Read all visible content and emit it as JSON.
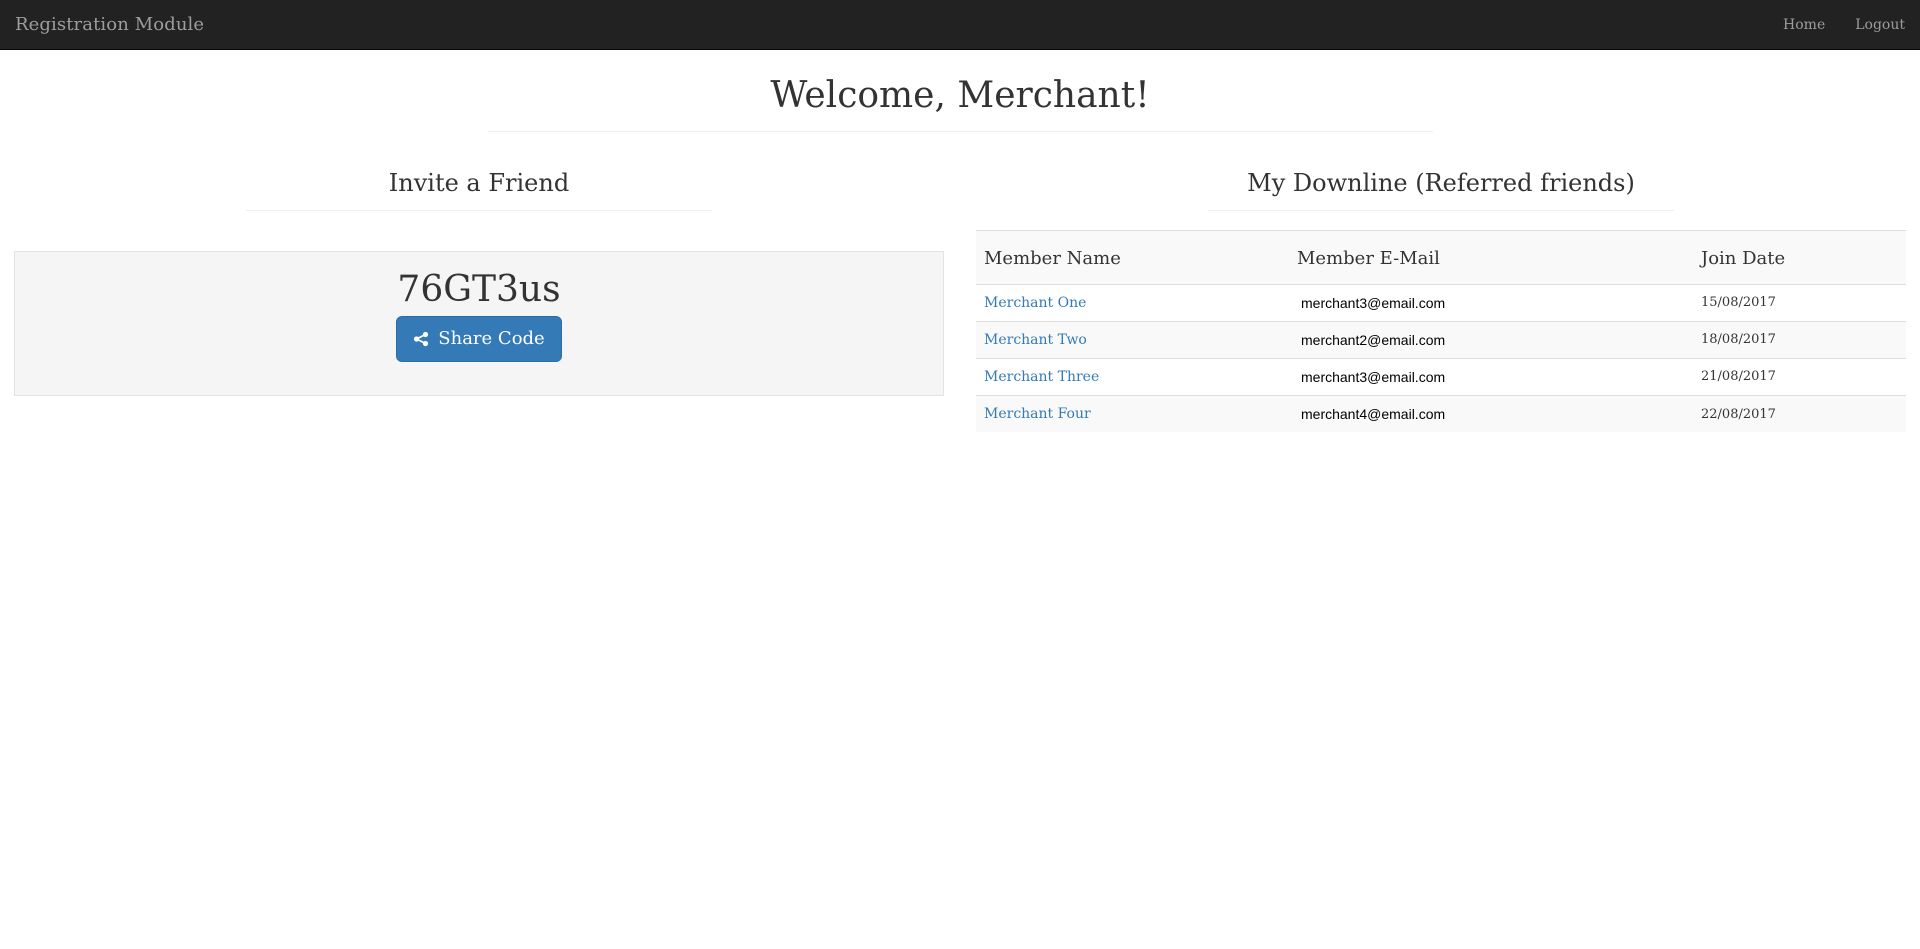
{
  "navbar": {
    "brand": "Registration Module",
    "links": [
      {
        "label": "Home"
      },
      {
        "label": "Logout"
      }
    ]
  },
  "page": {
    "title": "Welcome, Merchant!"
  },
  "invite": {
    "title": "Invite a Friend",
    "code": "76GT3us",
    "share_label": "Share Code",
    "share_icon": "share-icon"
  },
  "downline": {
    "title": "My Downline (Referred friends)",
    "columns": [
      "Member Name",
      "Member E-Mail",
      "Join Date"
    ],
    "rows": [
      {
        "name": "Merchant One",
        "email": "merchant3@email.com",
        "date": "15/08/2017"
      },
      {
        "name": "Merchant Two",
        "email": "merchant2@email.com",
        "date": "18/08/2017"
      },
      {
        "name": "Merchant Three",
        "email": "merchant3@email.com",
        "date": "21/08/2017"
      },
      {
        "name": "Merchant Four",
        "email": "merchant4@email.com",
        "date": "22/08/2017"
      }
    ]
  },
  "colors": {
    "navbar_bg": "#222222",
    "nav_text": "#9d9d9d",
    "primary": "#337ab7",
    "well_bg": "#f5f5f5"
  }
}
